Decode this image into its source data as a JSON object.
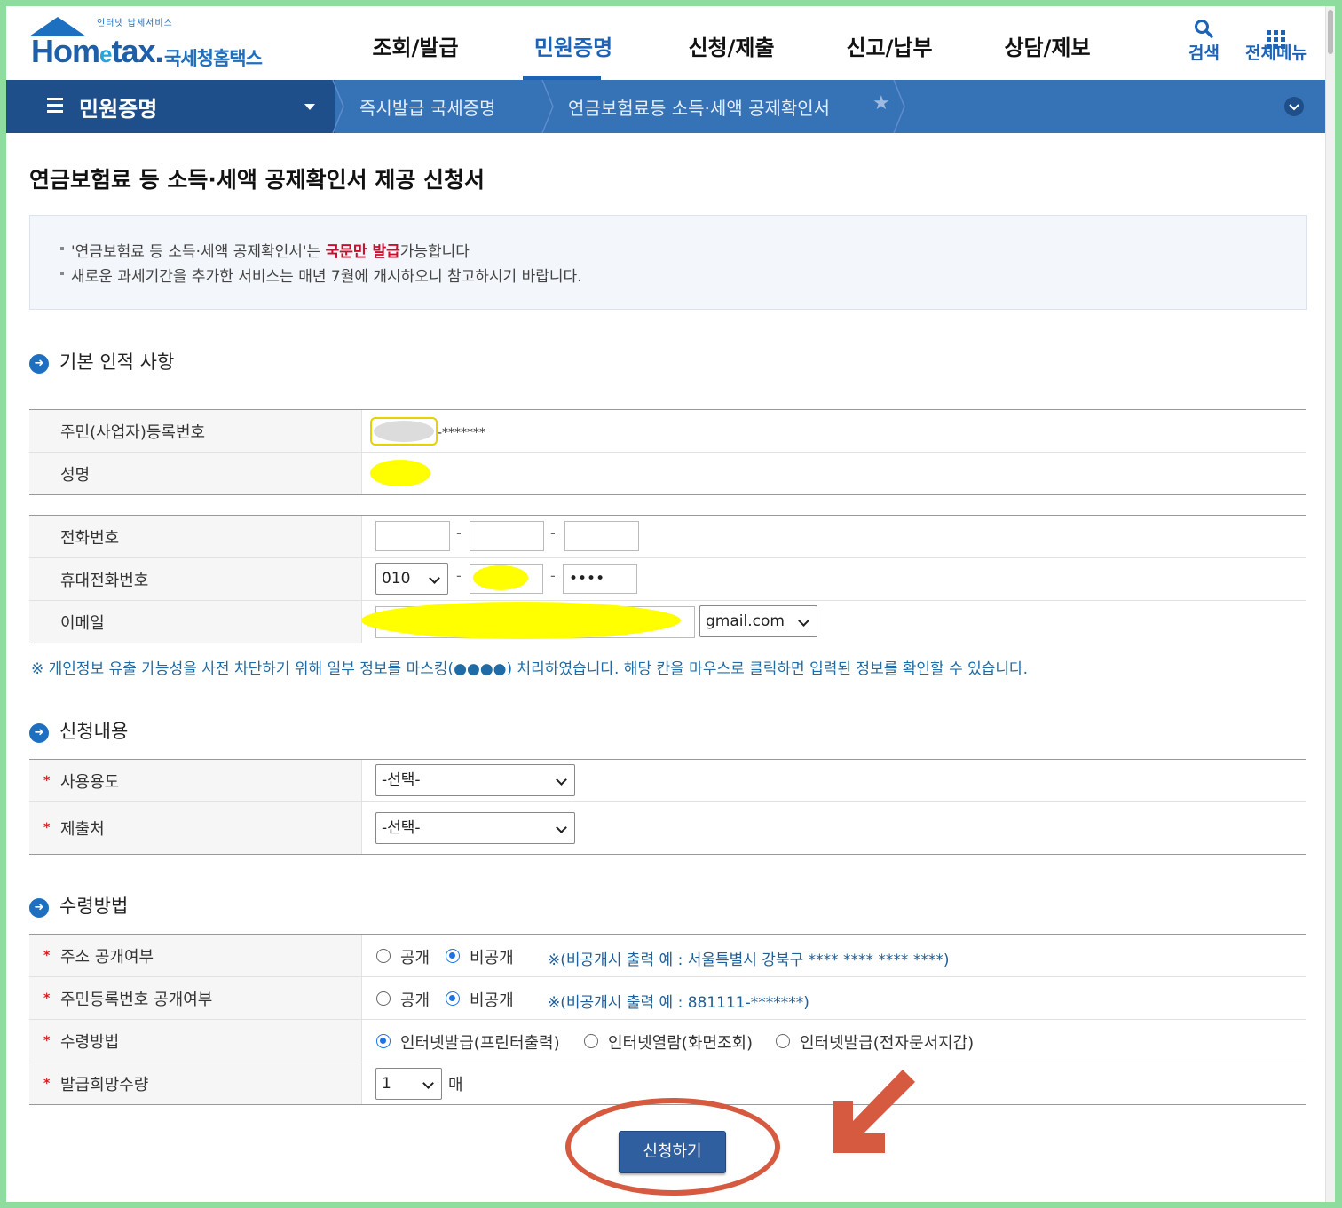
{
  "header": {
    "logo_small": "인터넷 납세서비스",
    "logo_brand_1": "Hom",
    "logo_brand_e": "e",
    "logo_brand_2": "tax.",
    "logo_kor": "국세청홈택스",
    "nav": [
      "조회/발급",
      "민원증명",
      "신청/제출",
      "신고/납부",
      "상담/제보"
    ],
    "active_nav_index": 1,
    "search_label": "검색",
    "menu_label": "전체메뉴"
  },
  "locbar": {
    "menu_title": "민원증명",
    "crumb1": "즉시발급 국세증명",
    "crumb2": "연금보험료등 소득·세액 공제확인서"
  },
  "page": {
    "title": "연금보험료 등 소득·세액 공제확인서 제공 신청서",
    "notice_1a": "'연금보험료 등 소득·세액 공제확인서'는 ",
    "notice_1_red": "국문만 발급",
    "notice_1b": "가능합니다",
    "notice_2": "새로운 과세기간을 추가한 서비스는 매년 7월에 개시하오니 참고하시기 바랍니다."
  },
  "basic": {
    "section": "기본 인적 사항",
    "rrn_label": "주민(사업자)등록번호",
    "rrn_suffix": "-*******",
    "name_label": "성명",
    "phone_label": "전화번호",
    "mobile_label": "휴대전화번호",
    "mobile_prefix": "010",
    "mobile_last": "••••",
    "email_label": "이메일",
    "email_domain": "gmail.com",
    "dash": "-",
    "mask_note": "※ 개인정보 유출 가능성을 사전 차단하기 위해 일부 정보를 마스킹(●●●●) 처리하였습니다. 해당 칸을 마우스로 클릭하면 입력된 정보를 확인할 수 있습니다."
  },
  "request": {
    "section": "신청내용",
    "purpose_label": "사용용도",
    "purpose_value": "-선택-",
    "submit_to_label": "제출처",
    "submit_to_value": "-선택-",
    "req_mark": "*"
  },
  "receive": {
    "section": "수령방법",
    "addr_label": "주소 공개여부",
    "rrn_public_label": "주민등록번호 공개여부",
    "method_label": "수령방법",
    "qty_label": "발급희망수량",
    "opt_public": "공개",
    "opt_private": "비공개",
    "addr_hint": "※(비공개시 출력 예 : 서울특별시 강북구 **** **** **** ****)",
    "rrn_hint": "※(비공개시 출력 예 : 881111-*******)",
    "method_opts": [
      "인터넷발급(프린터출력)",
      "인터넷열람(화면조회)",
      "인터넷발급(전자문서지갑)"
    ],
    "qty_value": "1",
    "qty_unit": "매"
  },
  "submit_button": "신청하기",
  "colors": {
    "primary": "#1c63b5",
    "locbar": "#3673b6",
    "annotation": "#d65a3f",
    "highlight": "#ffff00"
  }
}
